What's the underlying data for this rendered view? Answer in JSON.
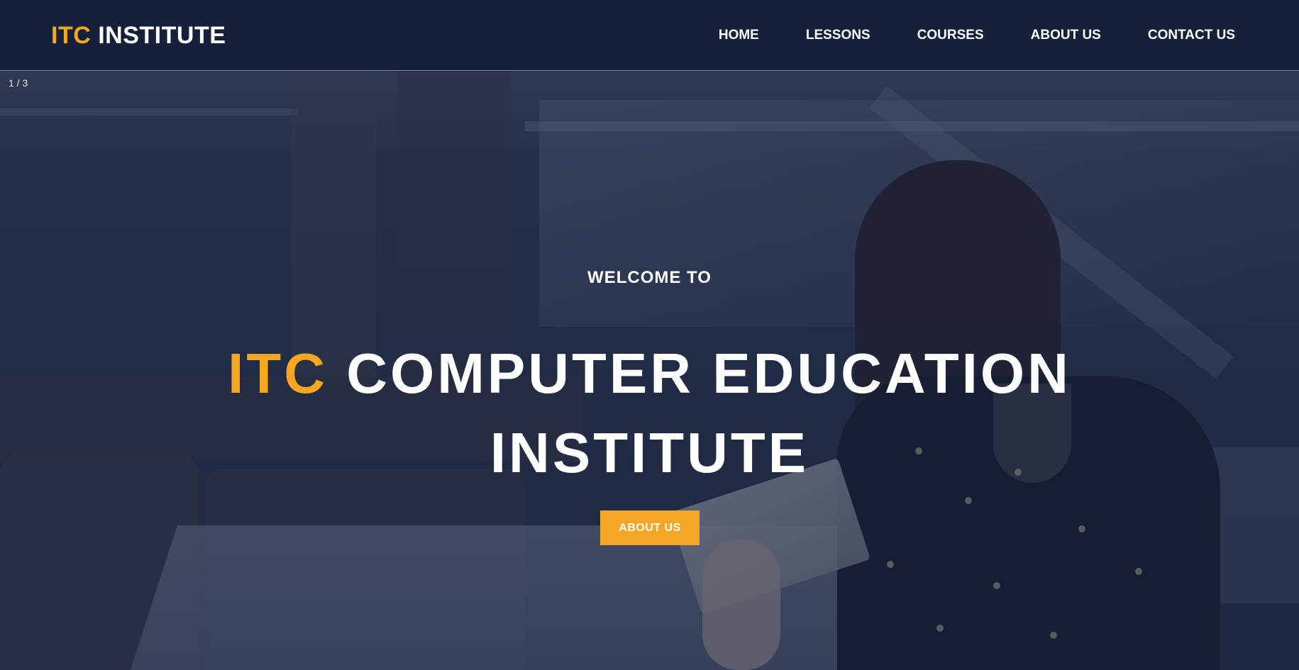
{
  "header": {
    "logo_accent": "ITC",
    "logo_rest": "INSTITUTE",
    "nav": [
      "HOME",
      "LESSONS",
      "COURSES",
      "ABOUT US",
      "CONTACT US"
    ]
  },
  "hero": {
    "slide_counter": "1 / 3",
    "welcome": "WELCOME TO",
    "title_accent": "ITC",
    "title_rest_line1": "COMPUTER EDUCATION",
    "title_line2": "INSTITUTE",
    "button_label": "ABOUT US"
  },
  "colors": {
    "accent": "#f5a623",
    "header_bg": "#15203b",
    "text": "#ffffff"
  }
}
